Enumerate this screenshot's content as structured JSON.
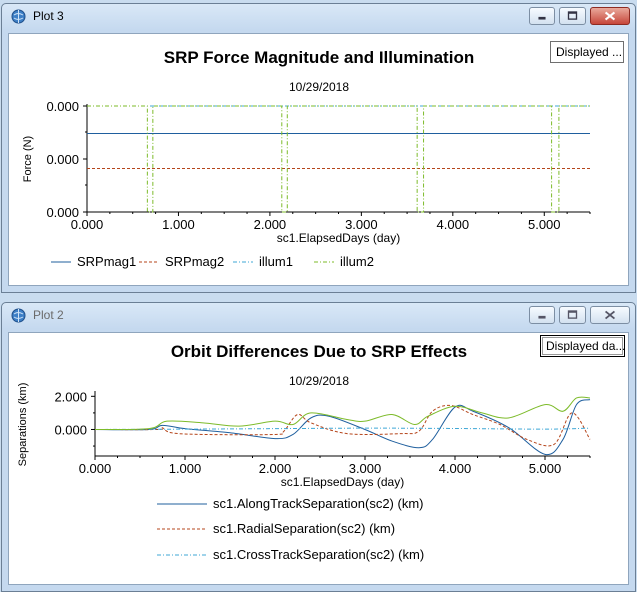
{
  "windows": [
    {
      "title": "Plot 3",
      "badge": "Displayed ...",
      "chart_data": {
        "type": "line",
        "title": "SRP Force Magnitude and Illumination",
        "subtitle": "10/29/2018",
        "xlabel": "sc1.ElapsedDays (day)",
        "ylabel": "Force (N)",
        "xlim": [
          0,
          5.5
        ],
        "x_ticks": [
          "0.000",
          "1.000",
          "2.000",
          "3.000",
          "4.000",
          "5.000"
        ],
        "y_ticks": [
          "0.000",
          "0.000",
          "0.000"
        ],
        "legend_position": "bottom",
        "series": [
          {
            "name": "SRPmag1",
            "color": "#1f5f9e",
            "style": "solid",
            "level": 0.74
          },
          {
            "name": "SRPmag2",
            "color": "#b5451b",
            "style": "dashed",
            "level": 0.41
          },
          {
            "name": "illum1",
            "color": "#3fa7d6",
            "style": "dash-dot",
            "level": 1.0
          },
          {
            "name": "illum2",
            "color": "#7dbb2a",
            "style": "dash-dot",
            "eclipses": [
              [
                0.66,
                0.72
              ],
              [
                2.13,
                2.19
              ],
              [
                3.61,
                3.68
              ],
              [
                5.08,
                5.16
              ]
            ]
          }
        ]
      }
    },
    {
      "title": "Plot 2",
      "badge": "Displayed da...",
      "chart_data": {
        "type": "line",
        "title": "Orbit Differences Due to SRP Effects",
        "subtitle": "10/29/2018",
        "xlabel": "sc1.ElapsedDays (day)",
        "ylabel": "Separations (km)",
        "xlim": [
          0,
          5.5
        ],
        "ylim": [
          -1.6,
          2.2
        ],
        "x_ticks": [
          "0.000",
          "1.000",
          "2.000",
          "3.000",
          "4.000",
          "5.000"
        ],
        "y_ticks": [
          {
            "label": "2.000",
            "value": 2.0
          },
          {
            "label": "0.000",
            "value": 0.0
          }
        ],
        "legend_position": "bottom",
        "series": [
          {
            "name": "sc1.AlongTrackSeparation(sc2) (km)",
            "color": "#1f5f9e",
            "style": "solid",
            "points": [
              [
                0,
                0
              ],
              [
                0.6,
                0
              ],
              [
                0.75,
                0.25
              ],
              [
                1.0,
                0.05
              ],
              [
                1.5,
                -0.2
              ],
              [
                2.0,
                -0.55
              ],
              [
                2.2,
                -0.3
              ],
              [
                2.4,
                0.7
              ],
              [
                2.6,
                0.8
              ],
              [
                3.0,
                0
              ],
              [
                3.3,
                -0.7
              ],
              [
                3.6,
                -1.1
              ],
              [
                3.75,
                -0.6
              ],
              [
                4.0,
                1.35
              ],
              [
                4.2,
                1.1
              ],
              [
                4.6,
                0.1
              ],
              [
                5.0,
                -1.5
              ],
              [
                5.2,
                -0.6
              ],
              [
                5.35,
                1.5
              ],
              [
                5.5,
                1.8
              ]
            ]
          },
          {
            "name": "sc1.RadialSeparation(sc2) (km)",
            "color": "#b5451b",
            "style": "dashed",
            "points": [
              [
                0,
                0
              ],
              [
                0.7,
                0
              ],
              [
                0.75,
                0.1
              ],
              [
                0.85,
                -0.2
              ],
              [
                1.2,
                -0.3
              ],
              [
                2.0,
                -0.3
              ],
              [
                2.1,
                -0.1
              ],
              [
                2.25,
                0.9
              ],
              [
                2.4,
                0.4
              ],
              [
                2.8,
                -0.25
              ],
              [
                3.4,
                -0.25
              ],
              [
                3.6,
                -0.1
              ],
              [
                3.75,
                1.1
              ],
              [
                3.95,
                1.45
              ],
              [
                4.2,
                0.9
              ],
              [
                4.5,
                0.3
              ],
              [
                4.8,
                -0.6
              ],
              [
                5.1,
                -0.9
              ],
              [
                5.3,
                1.0
              ],
              [
                5.5,
                -0.6
              ]
            ]
          },
          {
            "name": "sc1.CrossTrackSeparation(sc2) (km)",
            "color": "#3fa7d6",
            "style": "dash-dot",
            "points": [
              [
                0,
                0
              ],
              [
                1.0,
                0.02
              ],
              [
                2.0,
                0.05
              ],
              [
                3.0,
                0.08
              ],
              [
                4.0,
                0.06
              ],
              [
                5.0,
                0.02
              ],
              [
                5.5,
                0.08
              ]
            ]
          },
          {
            "name": "",
            "color": "#7dbb2a",
            "style": "solid",
            "points": [
              [
                0,
                0
              ],
              [
                0.6,
                0.05
              ],
              [
                0.8,
                0.5
              ],
              [
                1.2,
                0.4
              ],
              [
                1.6,
                0.2
              ],
              [
                2.0,
                0.5
              ],
              [
                2.2,
                0.3
              ],
              [
                2.4,
                1.0
              ],
              [
                2.8,
                0.6
              ],
              [
                3.0,
                0.5
              ],
              [
                3.3,
                0.9
              ],
              [
                3.55,
                0.3
              ],
              [
                3.7,
                0.8
              ],
              [
                4.0,
                1.4
              ],
              [
                4.3,
                1.0
              ],
              [
                4.6,
                0.7
              ],
              [
                5.0,
                1.5
              ],
              [
                5.2,
                1.1
              ],
              [
                5.35,
                1.9
              ],
              [
                5.5,
                1.9
              ]
            ]
          }
        ]
      }
    }
  ]
}
